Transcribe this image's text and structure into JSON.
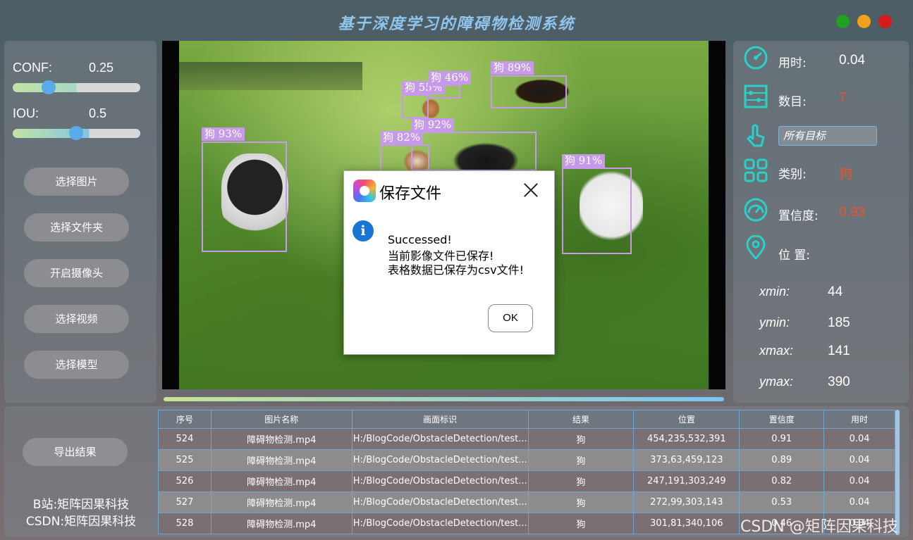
{
  "app": {
    "title": "基于深度学习的障碍物检测系统"
  },
  "sliders": {
    "conf": {
      "label": "CONF:",
      "value": "0.25",
      "fraction": 0.25
    },
    "iou": {
      "label": "IOU:",
      "value": "0.5",
      "fraction": 0.5
    }
  },
  "buttons": {
    "select_image": "选择图片",
    "select_folder": "选择文件夹",
    "open_camera": "开启摄像头",
    "select_video": "选择视频",
    "select_model": "选择模型",
    "export_results": "导出结果"
  },
  "detections": [
    {
      "label": "狗 93%"
    },
    {
      "label": "狗 55%"
    },
    {
      "label": "狗 46%"
    },
    {
      "label": "狗 89%"
    },
    {
      "label": "狗 92%"
    },
    {
      "label": "狗 82%"
    },
    {
      "label": "狗 91%"
    }
  ],
  "info": {
    "time_label": "用时:",
    "time_value": "0.04",
    "count_label": "数目:",
    "count_value": "7",
    "target_select": "所有目标",
    "class_label": "类别:",
    "class_value": "狗",
    "conf_label": "置信度:",
    "conf_value": "0.93",
    "pos_label": "位 置:",
    "xmin_label": "xmin:",
    "xmin_value": "44",
    "ymin_label": "ymin:",
    "ymin_value": "185",
    "xmax_label": "xmax:",
    "xmax_value": "141",
    "ymax_label": "ymax:",
    "ymax_value": "390",
    "value_color": "#e8572a"
  },
  "table": {
    "headers": [
      "序号",
      "图片名称",
      "画面标识",
      "结果",
      "位置",
      "置信度",
      "用时"
    ],
    "rows": [
      [
        "524",
        "障碍物检测.mp4",
        "H:/BlogCode/ObstacleDetection/test...",
        "狗",
        "454,235,532,391",
        "0.91",
        "0.04"
      ],
      [
        "525",
        "障碍物检测.mp4",
        "H:/BlogCode/ObstacleDetection/test...",
        "狗",
        "373,63,459,123",
        "0.89",
        "0.04"
      ],
      [
        "526",
        "障碍物检测.mp4",
        "H:/BlogCode/ObstacleDetection/test...",
        "狗",
        "247,191,303,249",
        "0.82",
        "0.04"
      ],
      [
        "527",
        "障碍物检测.mp4",
        "H:/BlogCode/ObstacleDetection/test...",
        "狗",
        "272,99,303,143",
        "0.53",
        "0.04"
      ],
      [
        "528",
        "障碍物检测.mp4",
        "H:/BlogCode/ObstacleDetection/test...",
        "狗",
        "301,81,340,106",
        "0.46",
        "0.04"
      ]
    ]
  },
  "credits": {
    "bilibili": "B站:矩阵因果科技",
    "csdn": "CSDN:矩阵因果科技"
  },
  "watermark": "CSDN @矩阵因果科技",
  "dialog": {
    "title": "保存文件",
    "line1": "Successed!",
    "line2": "当前影像文件已保存!",
    "line3": "表格数据已保存为csv文件!",
    "ok": "OK"
  }
}
